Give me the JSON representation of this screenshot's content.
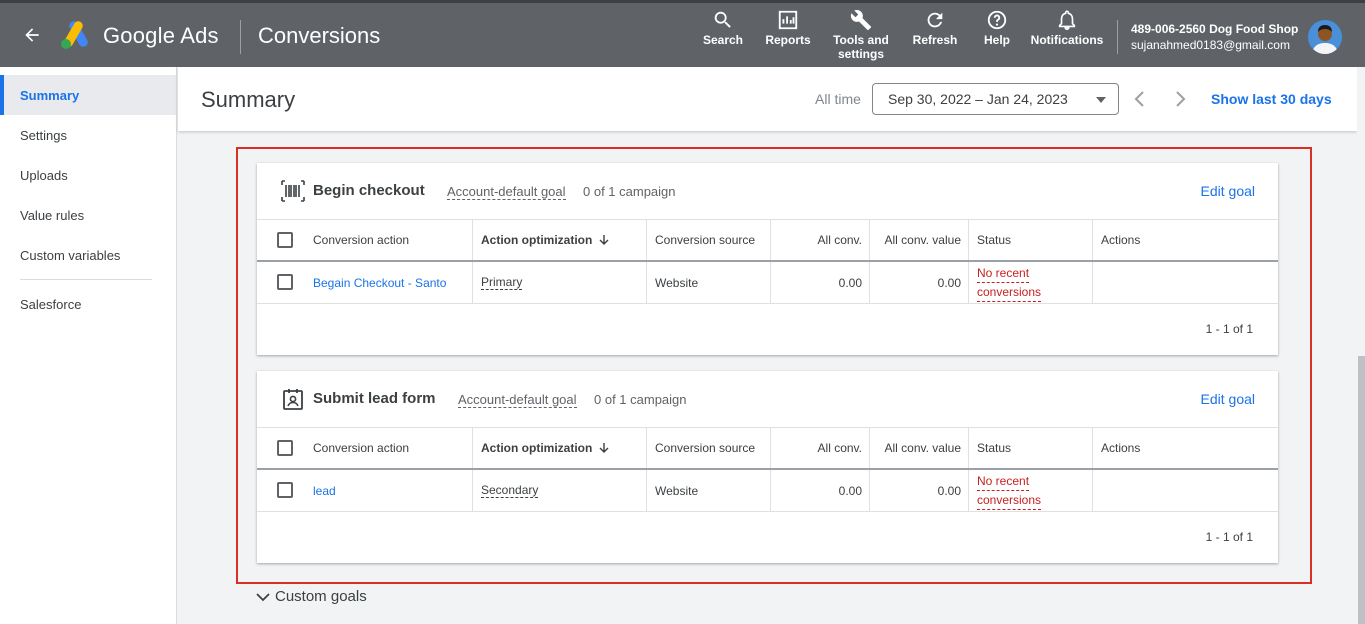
{
  "topbar": {
    "brand": "Google Ads",
    "page": "Conversions",
    "items": [
      {
        "label": "Search",
        "icon": "search-icon"
      },
      {
        "label": "Reports",
        "icon": "reports-icon"
      },
      {
        "label": "Tools and settings",
        "icon": "wrench-icon"
      },
      {
        "label": "Refresh",
        "icon": "refresh-icon"
      },
      {
        "label": "Help",
        "icon": "help-icon"
      },
      {
        "label": "Notifications",
        "icon": "bell-icon"
      }
    ],
    "account_name": "489-006-2560 Dog Food Shop",
    "account_email": "sujanahmed0183@gmail.com"
  },
  "sidebar": {
    "items": [
      {
        "label": "Summary",
        "active": true
      },
      {
        "label": "Settings"
      },
      {
        "label": "Uploads"
      },
      {
        "label": "Value rules"
      },
      {
        "label": "Custom variables"
      },
      {
        "label": "Salesforce"
      }
    ]
  },
  "header": {
    "title": "Summary",
    "range_label": "All time",
    "date_range": "Sep 30, 2022 – Jan 24, 2023",
    "show_last": "Show last 30 days"
  },
  "columns": [
    "Conversion action",
    "Action optimization",
    "Conversion source",
    "All conv.",
    "All conv. value",
    "Status",
    "Actions"
  ],
  "cards": [
    {
      "title": "Begin checkout",
      "goal_tag": "Account-default goal",
      "campaigns": "0 of 1 campaign",
      "edit": "Edit goal",
      "icon": "barcode-icon",
      "row": {
        "action": "Begain Checkout - Santo",
        "optimization": "Primary",
        "source": "Website",
        "conv": "0.00",
        "value": "0.00",
        "status_line1": "No recent",
        "status_line2": "conversions"
      },
      "pager": "1 - 1 of 1"
    },
    {
      "title": "Submit lead form",
      "goal_tag": "Account-default goal",
      "campaigns": "0 of 1 campaign",
      "edit": "Edit goal",
      "icon": "contact-form-icon",
      "row": {
        "action": "lead",
        "optimization": "Secondary",
        "source": "Website",
        "conv": "0.00",
        "value": "0.00",
        "status_line1": "No recent",
        "status_line2": "conversions"
      },
      "pager": "1 - 1 of 1"
    }
  ],
  "custom_goals": "Custom goals",
  "colors": {
    "topbar": "#5f6368",
    "accent": "#1a73e8",
    "highlight": "#d93025",
    "status": "#c5221f"
  }
}
